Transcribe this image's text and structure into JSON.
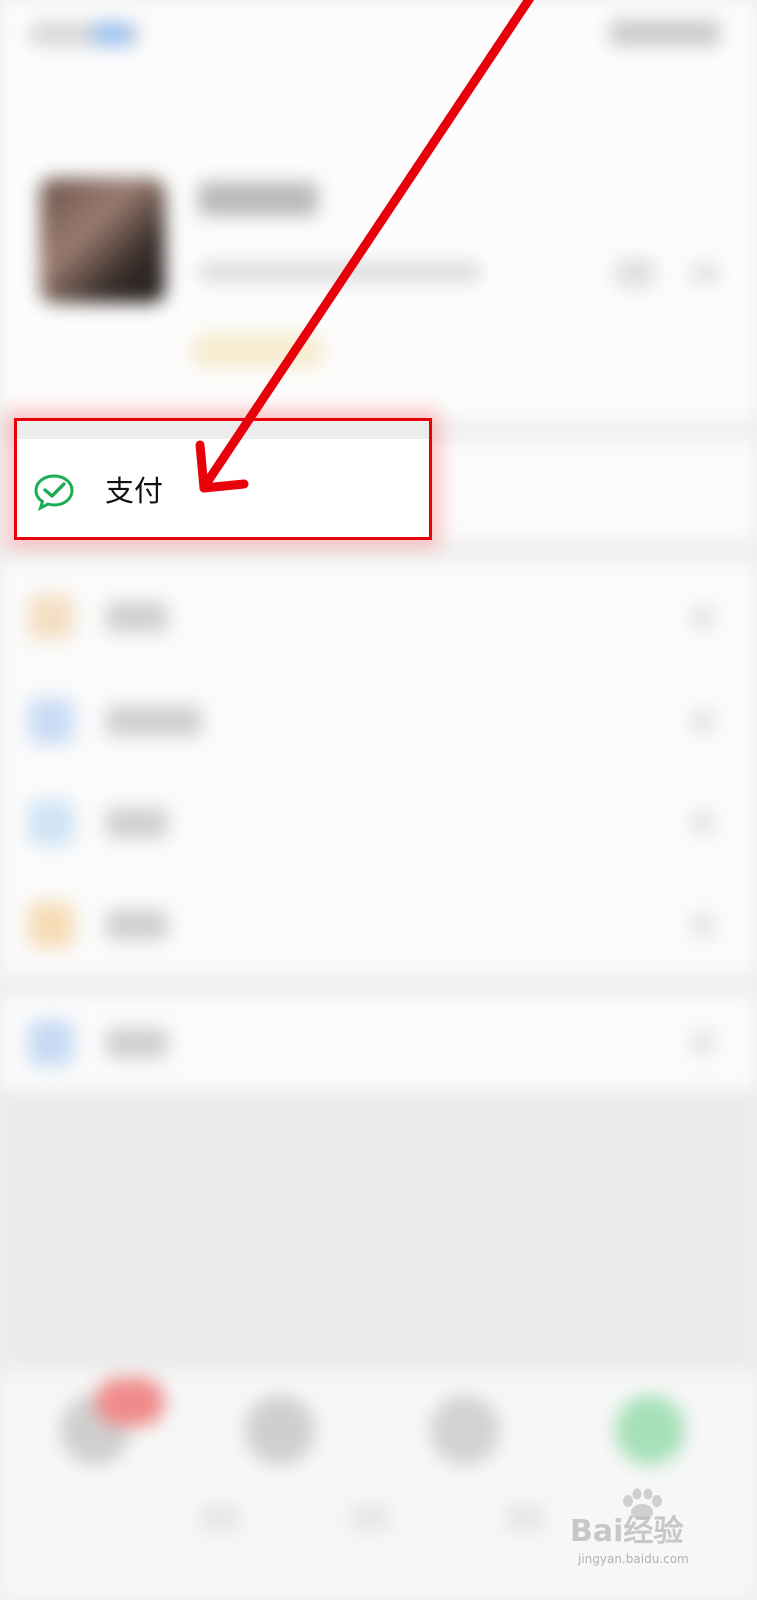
{
  "menu": {
    "pay_label": "支付"
  },
  "colors": {
    "annotation_red": "#e8000a",
    "wechat_pay_green": "#1aad54"
  },
  "icons": {
    "pay": "wechat-pay-icon"
  },
  "watermark": {
    "brand": "Bai经验",
    "url": "jingyan.baidu.com"
  }
}
